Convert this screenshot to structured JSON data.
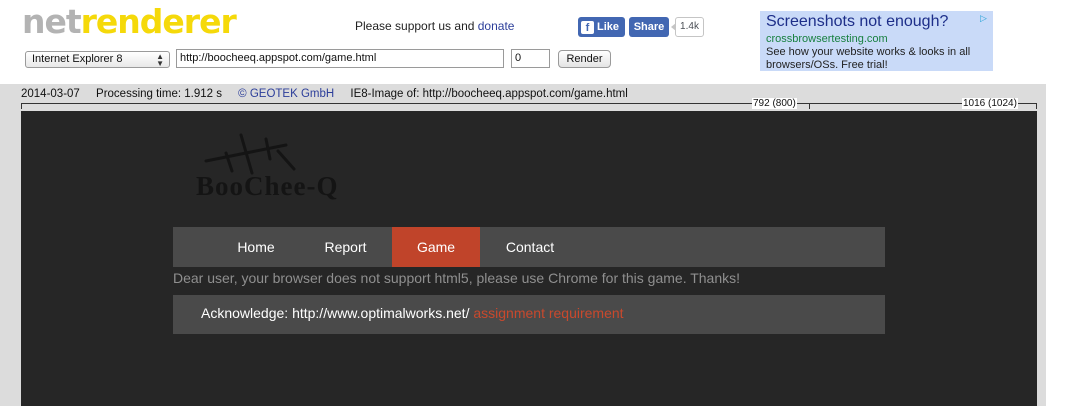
{
  "logo": {
    "part1": "net",
    "part2": "renderer"
  },
  "support": {
    "text": "Please support us and ",
    "link": "donate"
  },
  "facebook": {
    "like_label": "Like",
    "share_label": "Share",
    "count": "1.4k"
  },
  "toolbar": {
    "browser_selected": "Internet Explorer 8",
    "url_value": "http://boocheeq.appspot.com/game.html",
    "delay_value": "0",
    "render_label": "Render"
  },
  "ad": {
    "title": "Screenshots not enough?",
    "url": "crossbrowsertesting.com",
    "text": "See how your website works & looks in all browsers/OSs. Free trial!"
  },
  "info": {
    "date": "2014-03-07",
    "processing": "Processing time: 1.912 s",
    "copyright": "© GEOTEK GmbH",
    "image_of": "IE8-Image of: http://boocheeq.appspot.com/game.html"
  },
  "ruler": {
    "mark1": "792 (800)",
    "mark2": "1016 (1024)"
  },
  "site": {
    "logo_text": "BooChee-Q",
    "nav": [
      {
        "label": "Home",
        "active": false
      },
      {
        "label": "Report",
        "active": false
      },
      {
        "label": "Game",
        "active": true
      },
      {
        "label": "Contact",
        "active": false
      }
    ],
    "warning": "Dear user, your browser does not support html5, please use Chrome for this game. Thanks!",
    "ack_label": "Acknowledge: ",
    "ack_url": "http://www.optimalworks.net/",
    "ack_link": "assignment requirement"
  },
  "colors": {
    "nav_active": "#c0442a",
    "page_bg": "#262626",
    "nav_bg": "#4a4a4a",
    "logo_yellow": "#f5d90a"
  }
}
